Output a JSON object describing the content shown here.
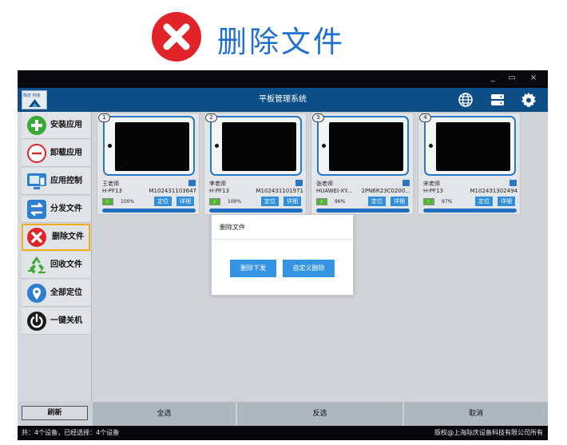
{
  "heading": {
    "title": "删除文件",
    "icon": "close-circle-icon",
    "accent": "#e0242a"
  },
  "window": {
    "controls": {
      "minimize": "_",
      "maximize": "▭",
      "close": "×"
    },
    "app_title": "平板管理系统",
    "logo_text": "陈庆 科技",
    "header_icons": [
      "globe-icon",
      "server-icon",
      "gear-icon"
    ]
  },
  "sidebar": {
    "items": [
      {
        "label": "安装应用",
        "icon": "plus-circle-icon"
      },
      {
        "label": "卸载应用",
        "icon": "minus-circle-icon"
      },
      {
        "label": "应用控制",
        "icon": "monitor-control-icon"
      },
      {
        "label": "分发文件",
        "icon": "transfer-icon"
      },
      {
        "label": "删除文件",
        "icon": "close-circle-icon",
        "active": true
      },
      {
        "label": "回收文件",
        "icon": "recycle-icon"
      },
      {
        "label": "全部定位",
        "icon": "location-pin-icon"
      },
      {
        "label": "一键关机",
        "icon": "power-icon"
      }
    ],
    "refresh_label": "刷新"
  },
  "devices": [
    {
      "index": "1",
      "name": "王老师",
      "model": "H-PF13",
      "serial": "M102431103647",
      "battery": "100%",
      "progress": 1.0,
      "locate": "定位",
      "detail": "详细"
    },
    {
      "index": "2",
      "name": "李老师",
      "model": "H-PF13",
      "serial": "M102431101971",
      "battery": "100%",
      "progress": 1.0,
      "locate": "定位",
      "detail": "详细"
    },
    {
      "index": "3",
      "name": "张老师",
      "model": "HUAWEI-XY...",
      "serial": "2PN6R23C0200...",
      "battery": "96%",
      "progress": 1.0,
      "locate": "定位",
      "detail": "详细"
    },
    {
      "index": "4",
      "name": "宋老师",
      "model": "H-PF13",
      "serial": "M102431302494",
      "battery": "97%",
      "progress": 1.0,
      "locate": "定位",
      "detail": "详细"
    }
  ],
  "bottom": {
    "select_all": "全选",
    "invert": "反选",
    "cancel": "取消"
  },
  "status": {
    "left": "共：4个设备，已经选择：4个设备",
    "right": "版权@上海际庆设备科技有限公司所有"
  },
  "dialog": {
    "title": "删除文件",
    "btn_delete_send": "删除下发",
    "btn_custom_delete": "自定义删除"
  },
  "colors": {
    "header": "#0c4f86",
    "button": "#3594e4",
    "active_border": "#f2ac1c"
  }
}
